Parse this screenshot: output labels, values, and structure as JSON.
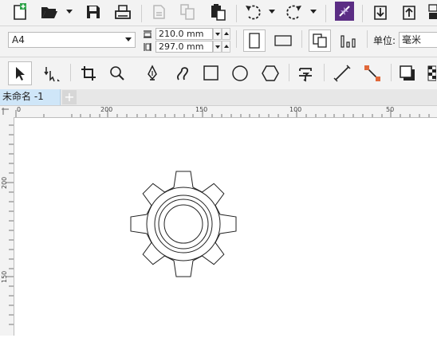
{
  "property_bar": {
    "page_size": "A4",
    "width_value": "210.0 mm",
    "height_value": "297.0 mm",
    "units_label": "单位:",
    "units_value": "毫米"
  },
  "tab": {
    "title": "未命名 -1",
    "add_label": "+"
  },
  "rulers": {
    "horizontal_labels": [
      "0",
      "200",
      "150",
      "100",
      "50"
    ],
    "vertical_labels": [
      "200",
      "150"
    ]
  },
  "standard_toolbar": {
    "icons": [
      "new-document-icon",
      "open-icon",
      "open-dropdown-icon",
      "save-icon",
      "print-icon",
      "cut-icon",
      "copy-icon",
      "paste-icon",
      "undo-icon",
      "undo-dropdown-icon",
      "redo-icon",
      "redo-dropdown-icon",
      "search-content-icon",
      "import-icon",
      "export-icon",
      "publish-pdf-icon"
    ]
  },
  "toolbox": {
    "icons": [
      "pick-tool-icon",
      "shape-tool-icon",
      "crop-tool-icon",
      "zoom-tool-icon",
      "pen-tool-icon",
      "artistic-media-icon",
      "rectangle-tool-icon",
      "ellipse-tool-icon",
      "polygon-tool-icon",
      "text-tool-icon",
      "dimension-tool-icon",
      "connector-tool-icon",
      "drop-shadow-icon",
      "transparency-icon"
    ]
  },
  "colors": {
    "accent": "#5b2d84",
    "tab_active": "#cfe6f8",
    "toolbar_bg": "#f3f3f3"
  }
}
